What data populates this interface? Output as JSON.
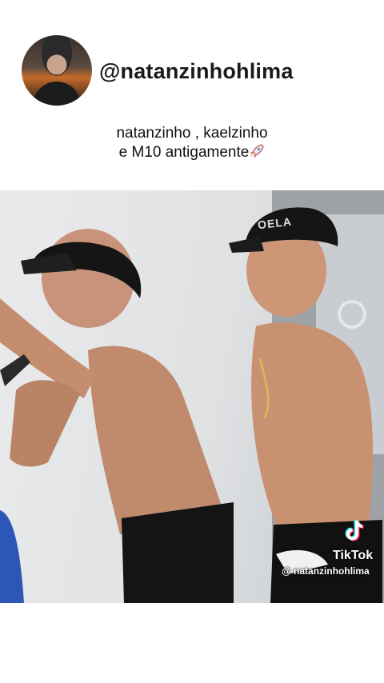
{
  "header": {
    "handle": "@natanzinhohlima",
    "caption_line1": "natanzinho , kaelzinho",
    "caption_line2": "e M10 antigamente",
    "caption_emoji": "rocket-icon"
  },
  "video": {
    "hat_text": "OELA",
    "watermark_brand": "TikTok",
    "watermark_user": "@ natanzinhohlima"
  },
  "colors": {
    "background": "#ffffff",
    "text": "#111111",
    "tiktok_cyan": "#25f4ee",
    "tiktok_red": "#fe2c55"
  }
}
